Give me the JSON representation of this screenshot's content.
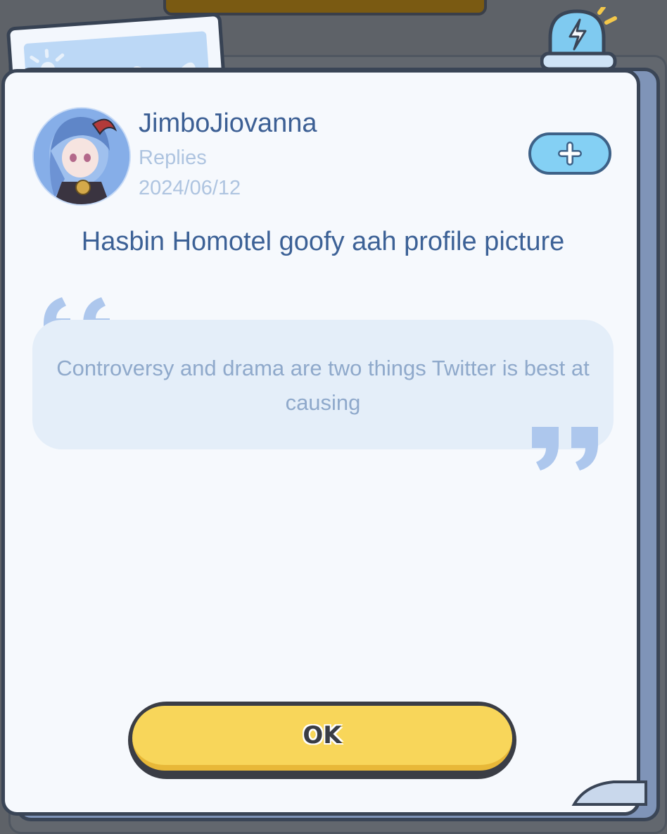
{
  "post": {
    "username": "JimboJiovanna",
    "category": "Replies",
    "date": "2024/06/12",
    "title": "Hasbin Homotel goofy aah profile picture",
    "quote": "Controversy and drama are two things Twitter is best at causing"
  },
  "actions": {
    "follow_icon": "plus-icon",
    "ok_label": "OK"
  },
  "colors": {
    "username": "#3c5f94",
    "meta": "#aec4e0",
    "quote_text": "#8fa9cb",
    "ok_button": "#f8d65a",
    "follow_button": "#84d0f4"
  }
}
